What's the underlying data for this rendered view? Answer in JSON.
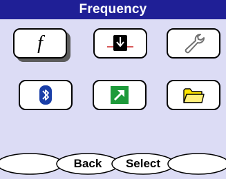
{
  "screen": {
    "title": "Frequency"
  },
  "grid": {
    "tiles": [
      {
        "name": "frequency-tile",
        "icon": "f-function-icon",
        "glyph": "f",
        "selected": true
      },
      {
        "name": "probe-tile",
        "icon": "probe-down-arrow-icon",
        "selected": false
      },
      {
        "name": "settings-tile",
        "icon": "wrench-icon",
        "selected": false
      },
      {
        "name": "bluetooth-tile",
        "icon": "bluetooth-icon",
        "selected": false
      },
      {
        "name": "export-tile",
        "icon": "export-arrow-icon",
        "selected": false
      },
      {
        "name": "folder-tile",
        "icon": "folder-icon",
        "selected": false
      }
    ]
  },
  "softkeys": {
    "left": "",
    "back": "Back",
    "select": "Select",
    "right": ""
  },
  "colors": {
    "background": "#dcdcf5",
    "title_bar": "#1f1f96",
    "bluetooth": "#1a3fa8",
    "export_green": "#1e9a3a",
    "folder_yellow": "#ffe600",
    "probe_red": "#cc2222"
  }
}
